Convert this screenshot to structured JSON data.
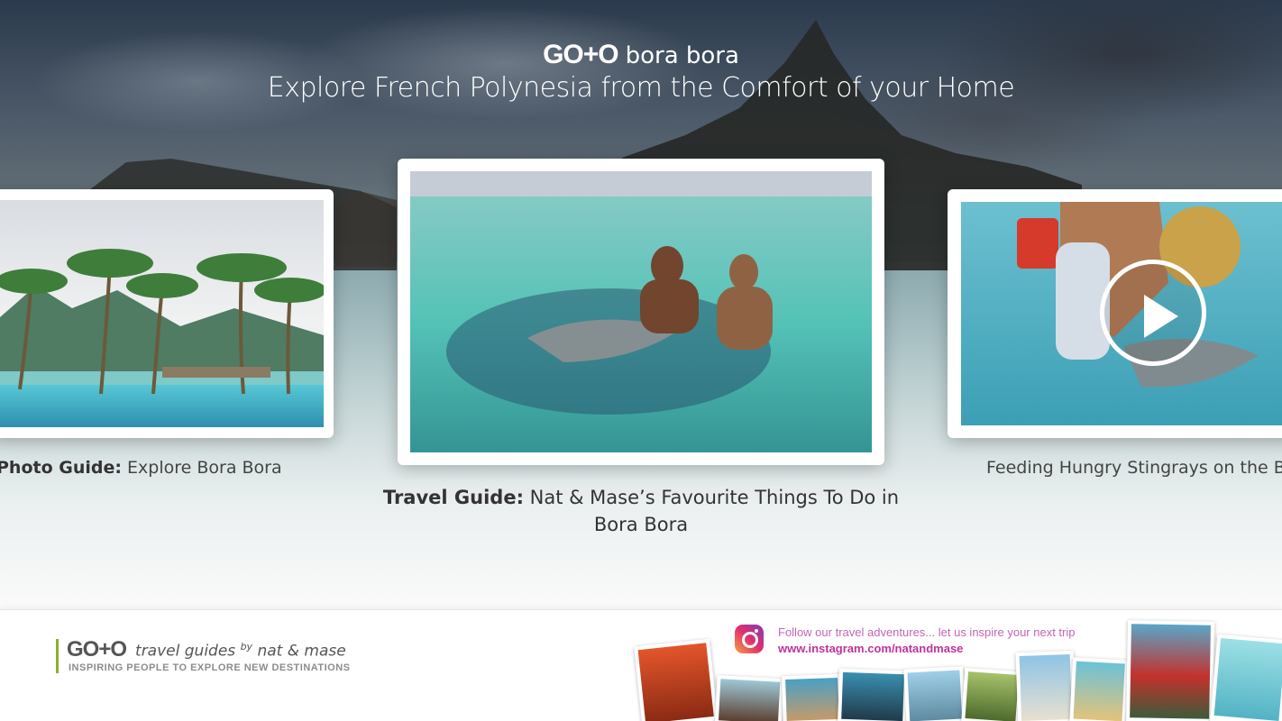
{
  "header": {
    "logo_goto": "GO+O",
    "logo_place": "bora bora",
    "subtitle": "Explore French Polynesia from the Comfort of your Home"
  },
  "carousel": {
    "items": [
      {
        "label_bold": "Photo Guide:",
        "label_rest": " Explore Bora Bora",
        "type": "photo"
      },
      {
        "label_bold": "Travel Guide:",
        "label_rest": " Nat & Mase’s Favourite Things To Do in Bora Bora",
        "type": "photo",
        "focused": true
      },
      {
        "label_bold": "",
        "label_rest": "Feeding Hungry Stingrays on the B",
        "type": "video"
      }
    ]
  },
  "footer": {
    "logo_goto": "GO+O",
    "logo_text": "travel guides",
    "logo_by": "by",
    "logo_names": "nat & mase",
    "tagline": "INSPIRING PEOPLE TO EXPLORE NEW DESTINATIONS",
    "instagram_text": "Follow our travel adventures... let us inspire your next trip",
    "instagram_url": "www.instagram.com/natandmase"
  },
  "colors": {
    "accent_green": "#8fae2b",
    "instagram_pink": "#c0339a"
  },
  "icons": [
    "play-icon",
    "instagram-icon"
  ]
}
